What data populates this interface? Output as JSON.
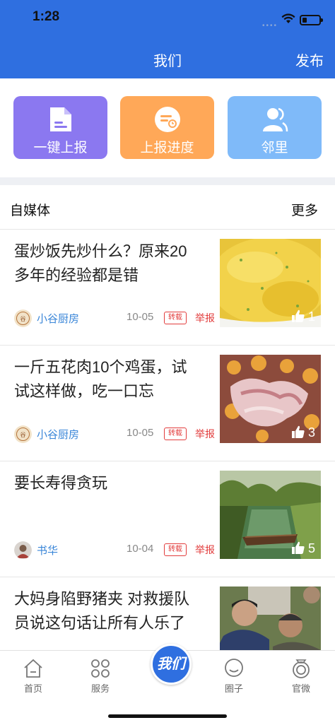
{
  "status_bar": {
    "time": "1:28",
    "signal_dots": "••••"
  },
  "nav": {
    "title": "我们",
    "action": "发布"
  },
  "quick_actions": [
    {
      "label": "一键上报",
      "icon": "document-icon",
      "color": "#8b78f0"
    },
    {
      "label": "上报进度",
      "icon": "progress-icon",
      "color": "#ffa858"
    },
    {
      "label": "邻里",
      "icon": "people-icon",
      "color": "#7fbaf9"
    }
  ],
  "section": {
    "title": "自媒体",
    "more": "更多"
  },
  "articles": [
    {
      "title": "蛋炒饭先炒什么？原来20多年的经验都是错",
      "author": "小谷厨房",
      "date": "10-05",
      "badge": "转载",
      "report": "举报",
      "likes": "1",
      "thumb": "fried-rice-photo"
    },
    {
      "title": "一斤五花肉10个鸡蛋，试试这样做，吃一口忘",
      "author": "小谷厨房",
      "date": "10-05",
      "badge": "转载",
      "report": "举报",
      "likes": "3",
      "thumb": "pork-eggs-photo"
    },
    {
      "title": "要长寿得贪玩",
      "author": "书华",
      "date": "10-04",
      "badge": "转载",
      "report": "举报",
      "likes": "5",
      "thumb": "canal-boat-photo"
    },
    {
      "title": "大妈身陷野猪夹 对救援队员说这句话让所有人乐了",
      "thumb": "rescue-photo"
    }
  ],
  "tabs": [
    {
      "label": "首页",
      "icon": "home-icon"
    },
    {
      "label": "服务",
      "icon": "services-icon"
    },
    {
      "label": "我们",
      "icon": "we-center-icon"
    },
    {
      "label": "圈子",
      "icon": "chat-icon"
    },
    {
      "label": "官微",
      "icon": "official-icon"
    }
  ],
  "colors": {
    "primary": "#2f6fe0",
    "report_red": "#e23c3c",
    "author_blue": "#3a86d8"
  }
}
